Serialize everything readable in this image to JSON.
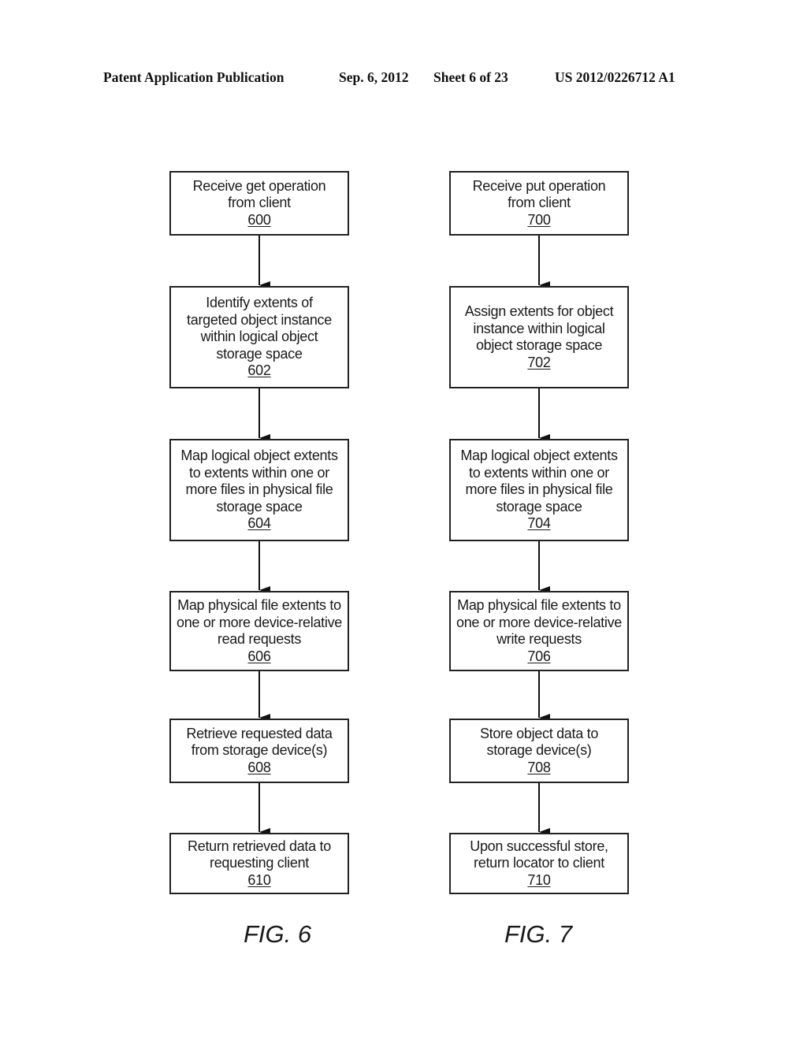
{
  "header": {
    "publication": "Patent Application Publication",
    "date": "Sep. 6, 2012",
    "sheet": "Sheet 6 of 23",
    "number": "US 2012/0226712 A1"
  },
  "figures": [
    {
      "caption": "FIG. 6",
      "steps": [
        {
          "lines": [
            "Receive get operation",
            "from client"
          ],
          "ref": "600"
        },
        {
          "lines": [
            "Identify extents of",
            "targeted object instance",
            "within logical object",
            "storage space"
          ],
          "ref": "602"
        },
        {
          "lines": [
            "Map logical object extents",
            "to extents within one or",
            "more files in physical file",
            "storage space"
          ],
          "ref": "604"
        },
        {
          "lines": [
            "Map physical file extents to",
            "one or more device-relative",
            "read requests"
          ],
          "ref": "606"
        },
        {
          "lines": [
            "Retrieve requested data",
            "from storage device(s)"
          ],
          "ref": "608"
        },
        {
          "lines": [
            "Return retrieved data to",
            "requesting client"
          ],
          "ref": "610"
        }
      ]
    },
    {
      "caption": "FIG. 7",
      "steps": [
        {
          "lines": [
            "Receive put operation",
            "from client"
          ],
          "ref": "700"
        },
        {
          "lines": [
            "Assign extents for object",
            "instance within logical",
            "object storage space"
          ],
          "ref": "702"
        },
        {
          "lines": [
            "Map logical object extents",
            "to extents within one or",
            "more files in physical file",
            "storage space"
          ],
          "ref": "704"
        },
        {
          "lines": [
            "Map physical file extents to",
            "one or more device-relative",
            "write requests"
          ],
          "ref": "706"
        },
        {
          "lines": [
            "Store object data to",
            "storage device(s)"
          ],
          "ref": "708"
        },
        {
          "lines": [
            "Upon successful store,",
            "return locator to client"
          ],
          "ref": "710"
        }
      ]
    }
  ]
}
